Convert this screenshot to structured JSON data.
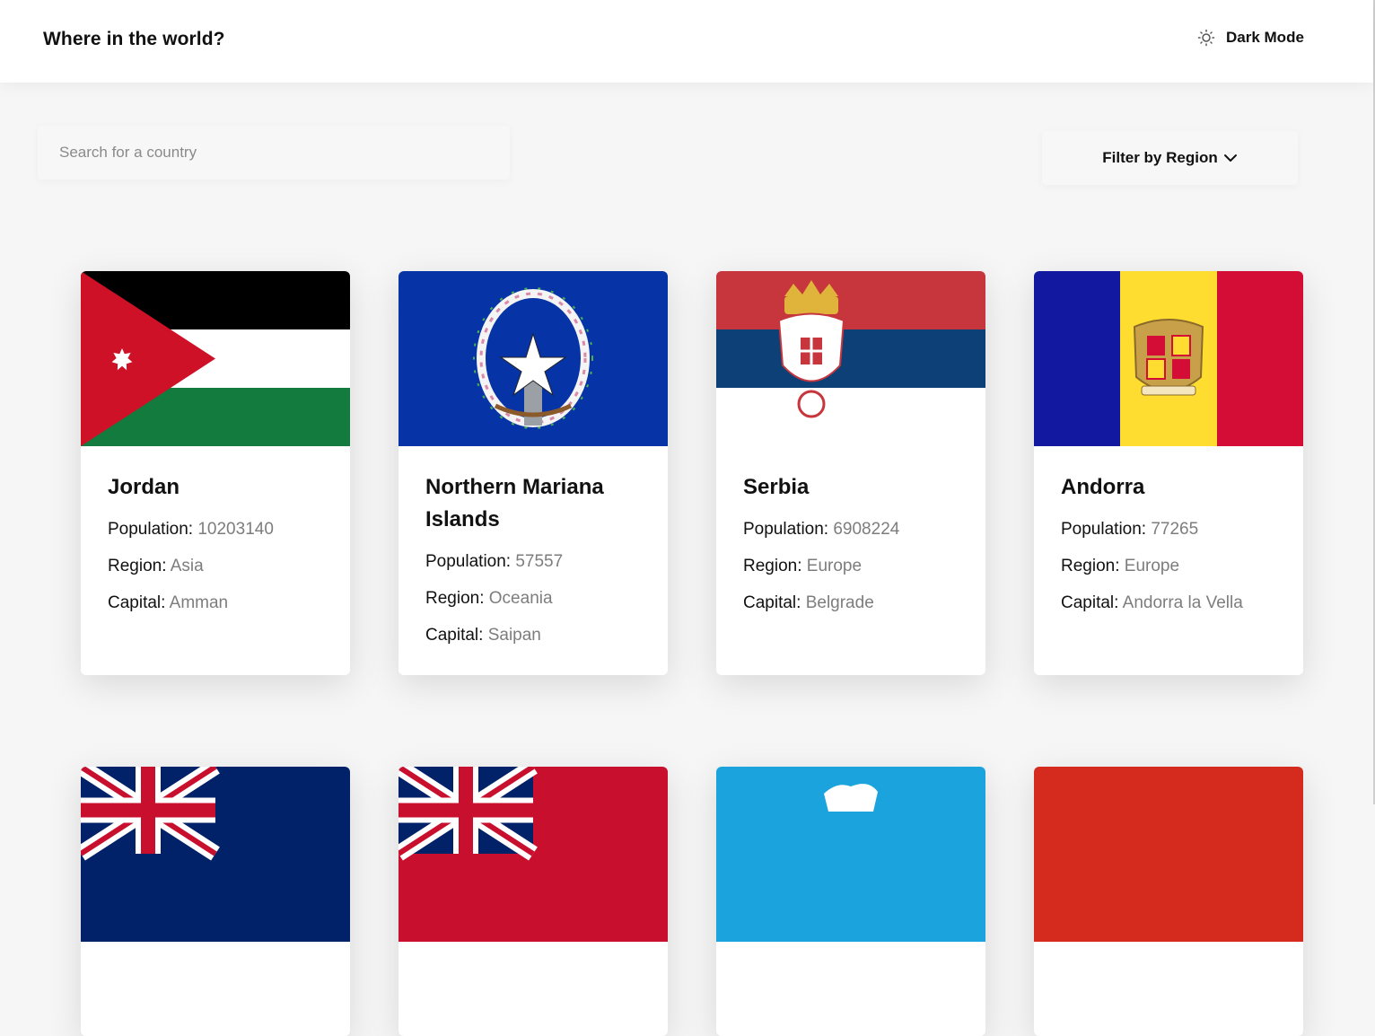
{
  "header": {
    "title": "Where in the world?",
    "theme_toggle_label": "Dark Mode",
    "theme_icon": "sun-icon"
  },
  "search": {
    "placeholder": "Search for a country",
    "icon": "none"
  },
  "filter": {
    "label": "Filter by Region",
    "icon": "chevron-down-icon"
  },
  "labels": {
    "population": "Population:",
    "region": "Region:",
    "capital": "Capital:"
  },
  "countries": [
    {
      "name": "Jordan",
      "population": "10203140",
      "region": "Asia",
      "capital": "Amman"
    },
    {
      "name": "Northern Mariana Islands",
      "population": "57557",
      "region": "Oceania",
      "capital": "Saipan"
    },
    {
      "name": "Serbia",
      "population": "6908224",
      "region": "Europe",
      "capital": "Belgrade"
    },
    {
      "name": "Andorra",
      "population": "77265",
      "region": "Europe",
      "capital": "Andorra la Vella"
    }
  ],
  "colors": {
    "background": "#f6f6f6",
    "card": "#ffffff",
    "value_text": "#7d7d7d"
  }
}
